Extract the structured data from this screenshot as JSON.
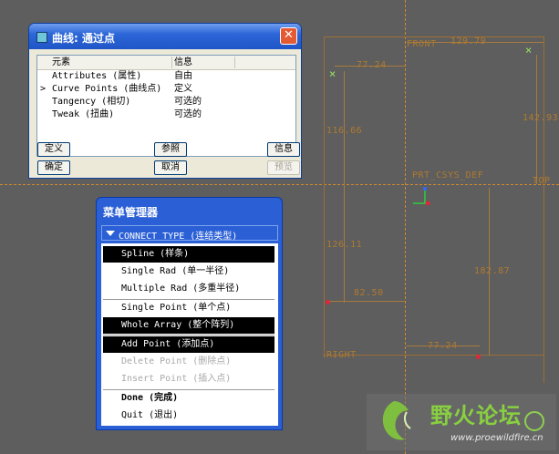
{
  "canvas": {
    "datum_labels": {
      "front": "FRONT",
      "top": "TOP",
      "right": "RIGHT",
      "csys": "PRT_CSYS_DEF"
    },
    "dimensions": {
      "top_width": "129.79",
      "left_offset": "77.24",
      "right_height": "142.93",
      "left_upper": "116.66",
      "left_lower": "126.11",
      "mid_width": "82.50",
      "center_height": "182.87",
      "bottom_width": "77.24"
    }
  },
  "dialog": {
    "title": "曲线: 通过点",
    "close_label": "✕",
    "table": {
      "headers": [
        "元素",
        "信息"
      ],
      "rows": [
        {
          "marker": "",
          "element": "Attributes (属性)",
          "info": "自由"
        },
        {
          "marker": ">",
          "element": "Curve Points (曲线点)",
          "info": "定义"
        },
        {
          "marker": "",
          "element": "Tangency (相切)",
          "info": "可选的"
        },
        {
          "marker": "",
          "element": "Tweak (扭曲)",
          "info": "可选的"
        }
      ]
    },
    "buttons": {
      "define": "定义",
      "reference": "参照",
      "info": "信息",
      "ok": "确定",
      "cancel": "取消",
      "preview": "预览"
    }
  },
  "menu_manager": {
    "title": "菜单管理器",
    "section": "CONNECT TYPE (连结类型)",
    "items": [
      {
        "label": "Spline (样条)",
        "state": "highlighted"
      },
      {
        "label": "Single Rad (单一半径)",
        "state": "normal"
      },
      {
        "label": "Multiple Rad (多重半径)",
        "state": "normal"
      },
      {
        "label": "Single Point (单个点)",
        "state": "normal"
      },
      {
        "label": "Whole Array (整个阵列)",
        "state": "highlighted"
      },
      {
        "label": "Add Point (添加点)",
        "state": "highlighted"
      },
      {
        "label": "Delete Point (删除点)",
        "state": "disabled"
      },
      {
        "label": "Insert Point (插入点)",
        "state": "disabled"
      },
      {
        "label": "Done (完成)",
        "state": "bold"
      },
      {
        "label": "Quit (退出)",
        "state": "normal"
      }
    ]
  },
  "watermark": {
    "title": "野火论坛",
    "url": "www.proewildfire.cn"
  },
  "colors": {
    "canvas_bg": "#5e5e5e",
    "datum": "#d38a2a",
    "dimension": "#b07a2e",
    "menu_blue": "#2a5fd6"
  }
}
